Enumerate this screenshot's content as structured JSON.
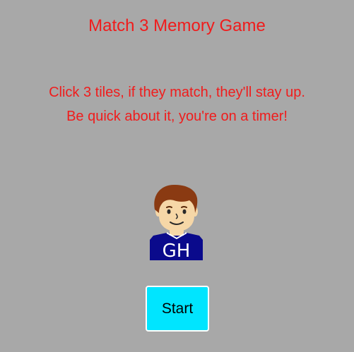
{
  "header": {
    "title": "Match 3 Memory Game"
  },
  "instructions": {
    "line1": "Click 3 tiles, if they match, they'll stay up.",
    "line2": "Be quick about it, you're on a timer!"
  },
  "avatar": {
    "initials": "GH",
    "icon": "boy-avatar-icon"
  },
  "controls": {
    "start_label": "Start"
  },
  "colors": {
    "background": "#a8a8a8",
    "text_accent": "#f01c1c",
    "button": "#00e5ff",
    "shirt": "#0a0a8c",
    "hair": "#8a3a12"
  }
}
